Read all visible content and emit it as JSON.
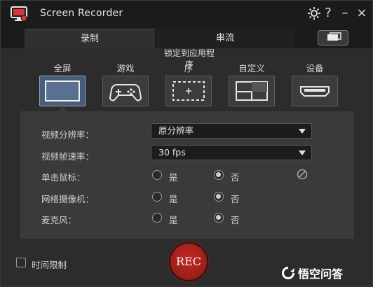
{
  "app": {
    "title": "Screen Recorder"
  },
  "titlebar": {
    "settings_icon": "gear-icon",
    "help_label": "?",
    "minimize_label": "–",
    "close_label": "×"
  },
  "tabs": [
    {
      "label": "录制"
    },
    {
      "label": "串流"
    }
  ],
  "capture": {
    "lock_label": "锁定到应用程序",
    "modes": [
      {
        "label": "全屏",
        "icon": "fullscreen-icon"
      },
      {
        "label": "游戏",
        "icon": "gamepad-icon"
      },
      {
        "label": "序",
        "icon": "region-select-icon"
      },
      {
        "label": "自定义",
        "icon": "custom-area-icon"
      },
      {
        "label": "设备",
        "icon": "hdmi-device-icon"
      }
    ]
  },
  "settings": {
    "resolution": {
      "label": "视频分辨率：",
      "value": "原分辨率"
    },
    "framerate": {
      "label": "视频帧速率：",
      "value": "30 fps"
    },
    "mouse_click": {
      "label": "单击鼠标：",
      "yes": "是",
      "no": "否",
      "selected": "no"
    },
    "webcam": {
      "label": "网络摄像机：",
      "yes": "是",
      "no": "否",
      "selected": "no"
    },
    "microphone": {
      "label": "麦克风：",
      "yes": "是",
      "no": "否",
      "selected": "no"
    }
  },
  "footer": {
    "time_limit_label": "时间限制",
    "rec_label": "REC"
  },
  "watermark": {
    "text": "悟空问答"
  },
  "colors": {
    "accent": "#4a5d78",
    "rec": "#b2241c"
  }
}
